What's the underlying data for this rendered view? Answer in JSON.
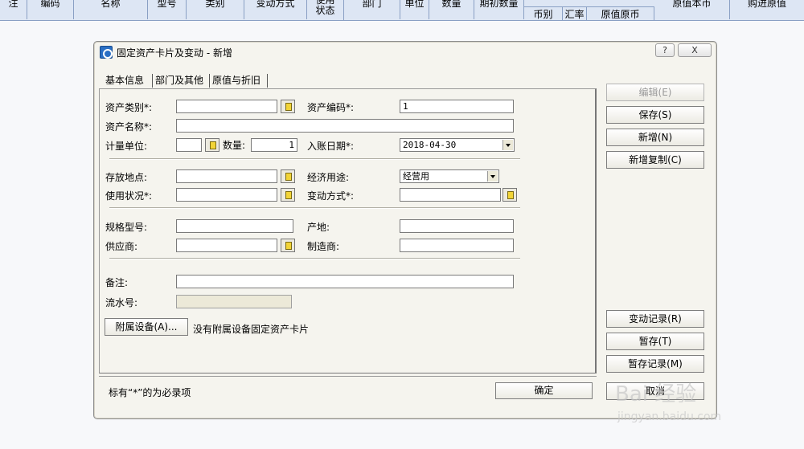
{
  "grid": {
    "columns": [
      "注",
      "编码",
      "名称",
      "型号",
      "类别",
      "变动方式",
      "使用状态",
      "部门",
      "单位",
      "数量",
      "期初数量",
      "币别",
      "汇率",
      "原值原币",
      "原值本币",
      "购进原值"
    ]
  },
  "dialog": {
    "title": "固定资产卡片及变动 - 新增",
    "help_label": "?",
    "close_label": "X",
    "tabs": [
      "基本信息",
      "部门及其他",
      "原值与折旧"
    ],
    "fields": {
      "asset_category_label": "资产类别*:",
      "asset_code_label": "资产编码*:",
      "asset_code_value": "1",
      "asset_name_label": "资产名称*:",
      "unit_label": "计量单位:",
      "quantity_label": "数量:",
      "quantity_value": "1",
      "entry_date_label": "入账日期*:",
      "entry_date_value": "2018-04-30",
      "location_label": "存放地点:",
      "purpose_label": "经济用途:",
      "purpose_value": "经营用",
      "usage_status_label": "使用状况*:",
      "change_method_label": "变动方式*:",
      "spec_label": "规格型号:",
      "origin_label": "产地:",
      "supplier_label": "供应商:",
      "manufacturer_label": "制造商:",
      "remark_label": "备注:",
      "serial_label": "流水号:"
    },
    "attach_button": "附属设备(A)...",
    "attach_note": "没有附属设备固定资产卡片",
    "status_text": "标有“*”的为必录项",
    "ok_button": "确定",
    "side_buttons": {
      "edit": "编辑(E)",
      "save": "保存(S)",
      "new": "新增(N)",
      "new_copy": "新增复制(C)",
      "change_record": "变动记录(R)",
      "hold": "暂存(T)",
      "hold_record": "暂存记录(M)",
      "cancel": "取消"
    }
  },
  "watermark": {
    "main": "Bai 经验",
    "sub": "jingyan.baidu.com"
  }
}
